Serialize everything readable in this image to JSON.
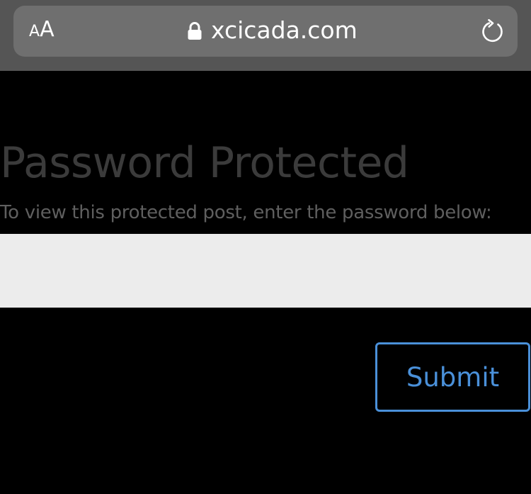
{
  "browser": {
    "text_size_small": "A",
    "text_size_large": "A",
    "domain": "xcicada.com",
    "lock_icon": "lock-icon",
    "reload_icon": "reload-icon"
  },
  "form": {
    "title": "Password Protected",
    "instructions": "To view this protected post, enter the password below:",
    "password_value": "",
    "submit_label": "Submit"
  },
  "colors": {
    "background": "#000000",
    "browser_bar": "#555555",
    "url_pill": "#6f6f6f",
    "title_text": "#3b3b3b",
    "instructions_text": "#5f5f5f",
    "input_background": "#ececec",
    "accent": "#4a90d9"
  }
}
